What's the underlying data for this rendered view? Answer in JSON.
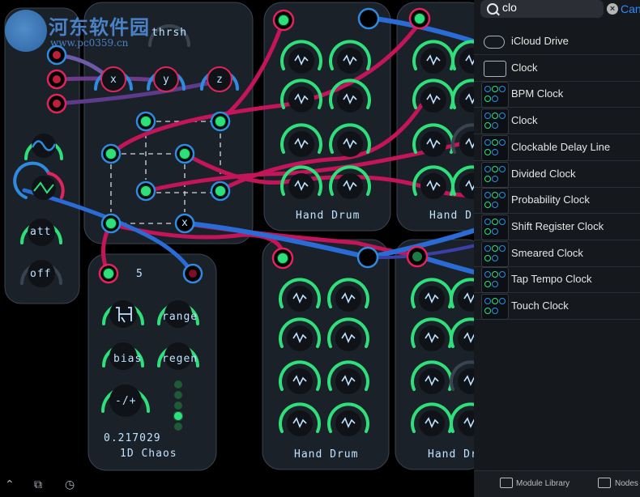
{
  "watermark": {
    "title": "河东软件园",
    "url": "www.pc0359.cn"
  },
  "modules": {
    "thresh": {
      "label": "thrsh"
    },
    "xyz": {
      "x_label": "x",
      "y_label": "y",
      "z_label": "z",
      "out_label": "x"
    },
    "lfo": {
      "att_label": "att",
      "off_label": "off"
    },
    "chaos": {
      "count": "5",
      "range_label": "range",
      "bias_label": "bias",
      "regen_label": "regen",
      "pm_label": "-/+",
      "value": "0.217029",
      "title": "1D Chaos"
    },
    "drum_a": {
      "title": "Hand Drum"
    },
    "drum_b": {
      "title": "Hand Dr"
    },
    "drum_c": {
      "title": "Hand Drum"
    },
    "drum_d": {
      "title": "Hand Dr"
    }
  },
  "library": {
    "search_value": "clo",
    "clear_icon": "×",
    "cancel_label": "Can",
    "items": [
      {
        "label": "iCloud Drive",
        "icon": "cloud-download-icon"
      },
      {
        "label": "Clock",
        "icon": "folder-icon"
      },
      {
        "label": "BPM Clock",
        "icon": "module-thumb"
      },
      {
        "label": "Clock",
        "icon": "module-thumb"
      },
      {
        "label": "Clockable Delay Line",
        "icon": "module-thumb"
      },
      {
        "label": "Divided Clock",
        "icon": "module-thumb"
      },
      {
        "label": "Probability Clock",
        "icon": "module-thumb"
      },
      {
        "label": "Shift Register Clock",
        "icon": "module-thumb"
      },
      {
        "label": "Smeared Clock",
        "icon": "module-thumb"
      },
      {
        "label": "Tap Tempo Clock",
        "icon": "module-thumb"
      },
      {
        "label": "Touch Clock",
        "icon": "module-thumb"
      }
    ],
    "footer": {
      "library_label": "Module Library",
      "nodes_label": "Nodes"
    }
  },
  "colors": {
    "accent_green": "#2fe07a",
    "accent_blue": "#2f8be0",
    "accent_red": "#e0245e",
    "cable_red": "#c4145a",
    "cable_blue": "#2b6bd6",
    "panel_bg": "#1b2129"
  }
}
